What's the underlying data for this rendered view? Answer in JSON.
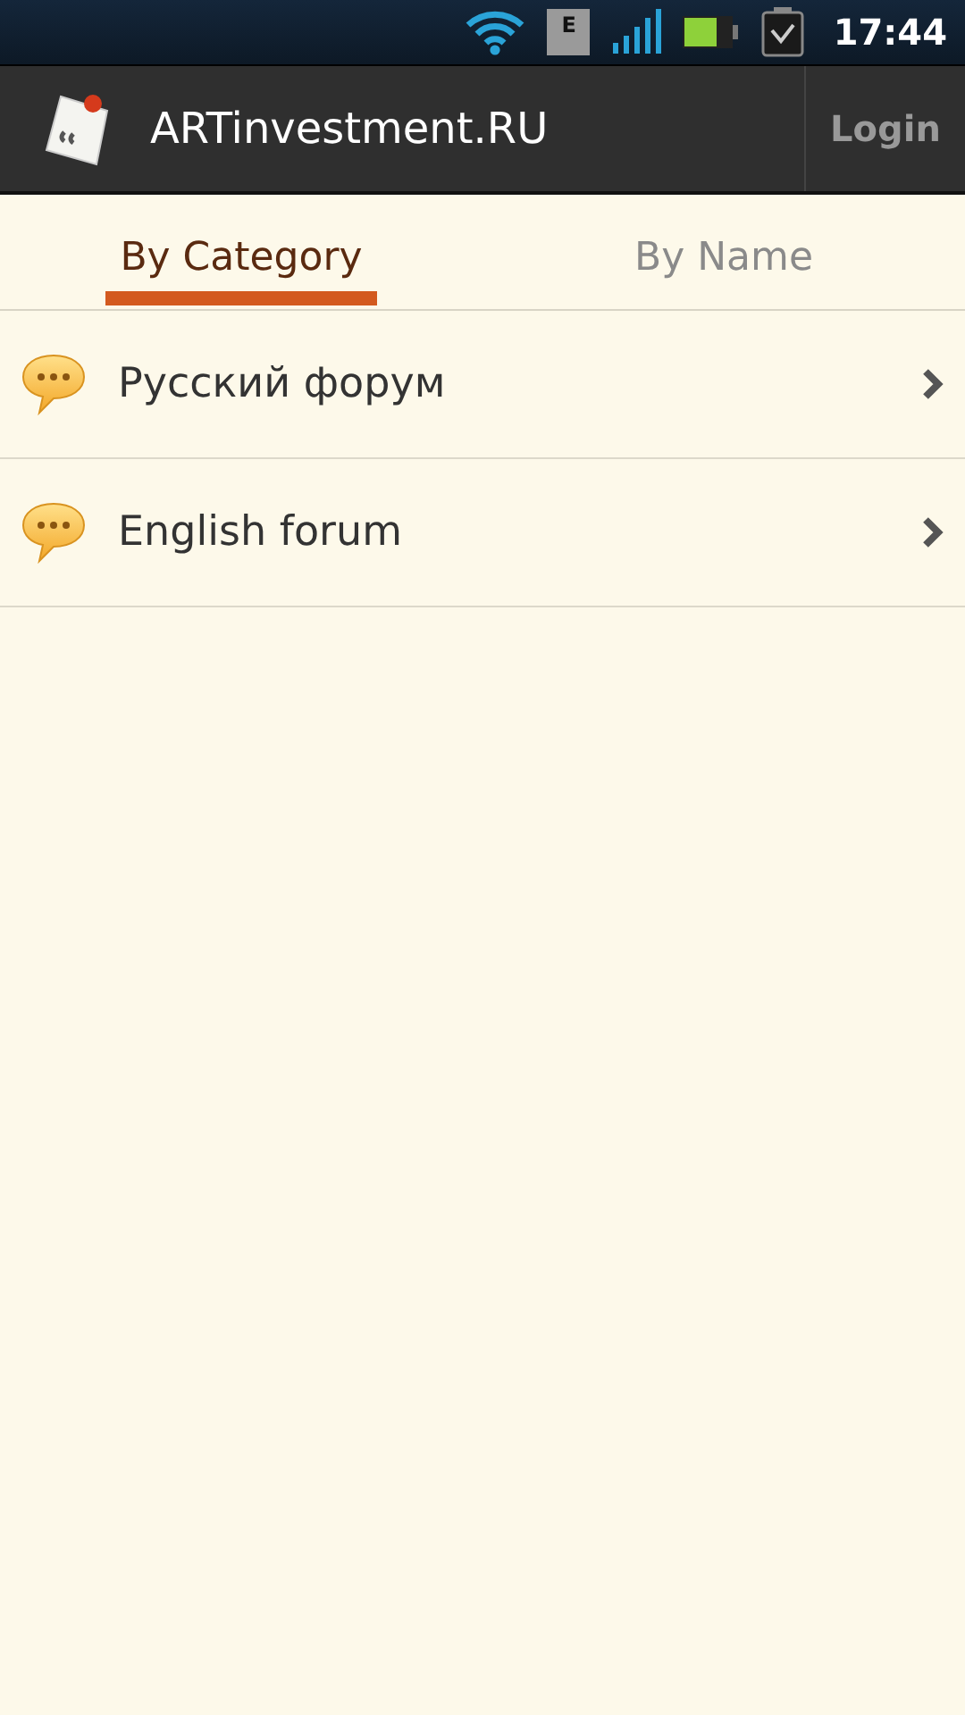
{
  "status_bar": {
    "network_type": "E",
    "time": "17:44"
  },
  "app_bar": {
    "title": "ARTinvestment.RU",
    "action": "Login"
  },
  "tabs": [
    {
      "label": "By Category",
      "selected": true
    },
    {
      "label": "By Name",
      "selected": false
    }
  ],
  "forums": [
    {
      "name": "Русский форум"
    },
    {
      "name": "English forum"
    }
  ]
}
